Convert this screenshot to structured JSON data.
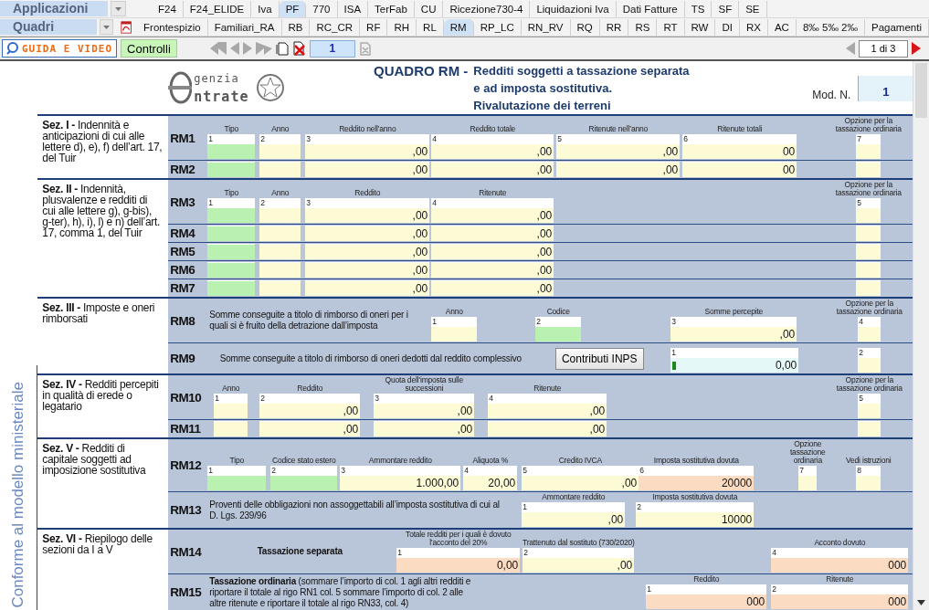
{
  "menus": [
    {
      "label": "Applicazioni",
      "has_pdf": false,
      "tabs": [
        {
          "label": "F24",
          "selected": false
        },
        {
          "label": "F24_ELIDE",
          "selected": false
        },
        {
          "label": "Iva",
          "selected": false
        },
        {
          "label": "PF",
          "selected": true
        },
        {
          "label": "770",
          "selected": false
        },
        {
          "label": "ISA",
          "selected": false
        },
        {
          "label": "TerFab",
          "selected": false
        },
        {
          "label": "CU",
          "selected": false
        },
        {
          "label": "Ricezione730-4",
          "selected": false
        },
        {
          "label": "Liquidazioni Iva",
          "selected": false
        },
        {
          "label": "Dati Fatture",
          "selected": false
        },
        {
          "label": "TS",
          "selected": false
        },
        {
          "label": "SF",
          "selected": false
        },
        {
          "label": "SE",
          "selected": false
        }
      ]
    },
    {
      "label": "Quadri",
      "has_pdf": true,
      "tabs": [
        {
          "label": "Frontespizio",
          "selected": false
        },
        {
          "label": "Familiari_RA",
          "selected": false
        },
        {
          "label": "RB",
          "selected": false
        },
        {
          "label": "RC_CR",
          "selected": false
        },
        {
          "label": "RF",
          "selected": false
        },
        {
          "label": "RH",
          "selected": false
        },
        {
          "label": "RL",
          "selected": false
        },
        {
          "label": "RM",
          "selected": true
        },
        {
          "label": "RP_LC",
          "selected": false
        },
        {
          "label": "RN_RV",
          "selected": false
        },
        {
          "label": "RQ",
          "selected": false
        },
        {
          "label": "RR",
          "selected": false
        },
        {
          "label": "RS",
          "selected": false
        },
        {
          "label": "RT",
          "selected": false
        },
        {
          "label": "RW",
          "selected": false
        },
        {
          "label": "DI",
          "selected": false
        },
        {
          "label": "RX",
          "selected": false
        },
        {
          "label": "AC",
          "selected": false
        },
        {
          "label": "8‰ 5‰ 2‰",
          "selected": false
        },
        {
          "label": "Pagamenti",
          "selected": false
        }
      ]
    }
  ],
  "toolbar": {
    "guide_button": "GUIDA E VIDEO",
    "check_button": "Controlli",
    "page_field": "1",
    "page_count": "1 di 3"
  },
  "header": {
    "logo_top": "genzia",
    "logo_bottom": "ntrate",
    "title": "QUADRO RM -",
    "subtitle_lines": [
      "Redditi soggetti a tassazione separata",
      "e ad imposta sostitutiva.",
      "Rivalutazione dei terreni"
    ],
    "mod_label": "Mod. N.",
    "mod_value": "1"
  },
  "side_note": "Conforme al modello ministeriale",
  "sections": [
    {
      "label": "**Sez. I -** Indennità e anticipazioni di cui alle lettere d), e), f) dell’art. 17, del Tuir",
      "rows": [
        {
          "code": "RM1",
          "items": [
            {
              "kind": "code",
              "header": "Tipo",
              "num": "1"
            },
            {
              "kind": "amount",
              "header": "Anno",
              "num": "2"
            },
            {
              "kind": "amount",
              "header": "Reddito nell’anno",
              "num": "3",
              "value": ",00"
            },
            {
              "kind": "amount",
              "header": "Reddito totale",
              "num": "4",
              "value": ",00"
            },
            {
              "kind": "amount",
              "header": "Ritenute nell’anno",
              "num": "5",
              "value": ",00"
            },
            {
              "kind": "amount",
              "header": "Ritenute totali",
              "num": "6",
              "value": "00"
            },
            {
              "kind": "amount",
              "header": "Opzione per la tassazione ordinaria",
              "num": "7"
            }
          ]
        },
        {
          "code": "RM2",
          "items": [
            {
              "kind": "code"
            },
            {
              "kind": "amount"
            },
            {
              "kind": "amount",
              "value": ",00"
            },
            {
              "kind": "amount",
              "value": ",00"
            },
            {
              "kind": "amount",
              "value": ",00"
            },
            {
              "kind": "amount",
              "value": "00"
            },
            {
              "kind": "amount"
            }
          ]
        }
      ]
    },
    {
      "label": "**Sez. II -** Indennità, plusvalenze e redditi di cui alle lettere g), g-bis), g-ter), h), i), l) e n) dell’art. 17, comma 1, del Tuir",
      "rows": [
        {
          "code": "RM3",
          "items": [
            {
              "kind": "code",
              "header": "Tipo",
              "num": "1"
            },
            {
              "kind": "amount",
              "header": "Anno",
              "num": "2"
            },
            {
              "kind": "amount",
              "header": "Reddito",
              "num": "3",
              "value": ",00"
            },
            {
              "kind": "amount",
              "header": "Ritenute",
              "num": "4",
              "value": ",00"
            },
            {
              "kind": "amount",
              "header": "Opzione per la tassazione ordinaria",
              "num": "5"
            }
          ]
        },
        {
          "code": "RM4",
          "items": [
            {
              "kind": "code"
            },
            {
              "kind": "amount"
            },
            {
              "kind": "amount",
              "value": ",00"
            },
            {
              "kind": "amount",
              "value": ",00"
            },
            {
              "kind": "amount"
            }
          ]
        },
        {
          "code": "RM5",
          "items": [
            {
              "kind": "code"
            },
            {
              "kind": "amount"
            },
            {
              "kind": "amount",
              "value": ",00"
            },
            {
              "kind": "amount",
              "value": ",00"
            },
            {
              "kind": "amount"
            }
          ]
        },
        {
          "code": "RM6",
          "items": [
            {
              "kind": "code"
            },
            {
              "kind": "amount"
            },
            {
              "kind": "amount",
              "value": ",00"
            },
            {
              "kind": "amount",
              "value": ",00"
            },
            {
              "kind": "amount"
            }
          ]
        },
        {
          "code": "RM7",
          "items": [
            {
              "kind": "code"
            },
            {
              "kind": "amount"
            },
            {
              "kind": "amount",
              "value": ",00"
            },
            {
              "kind": "amount",
              "value": ",00"
            },
            {
              "kind": "amount"
            }
          ]
        }
      ]
    },
    {
      "label": "**Sez. III -** Imposte e oneri rimborsati",
      "rows": [
        {
          "code": "RM8",
          "items": [
            {
              "kind": "text",
              "text": "Somme conseguite a titolo di rimborso di oneri per i quali si è fruito della detrazione dall’imposta",
              "bold": false
            },
            {
              "kind": "amount",
              "header": "Anno",
              "num": "1"
            },
            {
              "kind": "code",
              "header": "Codice",
              "num": "2"
            },
            {
              "kind": "amount",
              "header": "Somme percepite",
              "num": "3",
              "value": ",00"
            },
            {
              "kind": "amount",
              "header": "Opzione per la tassazione ordinaria",
              "num": "4"
            }
          ]
        },
        {
          "code": "RM9",
          "items": [
            {
              "kind": "text",
              "text": "Somme conseguite a titolo di rimborso di oneri dedotti dal reddito complessivo",
              "bold": false
            },
            {
              "kind": "button",
              "text": "Contributi INPS"
            },
            {
              "kind": "computed",
              "num": "1",
              "value": "0,00"
            },
            {
              "kind": "amount",
              "num": "2"
            }
          ]
        }
      ]
    },
    {
      "label": "**Sez. IV -** Redditi percepiti in qualità di erede o legatario",
      "rows": [
        {
          "code": "RM10",
          "items": [
            {
              "kind": "amount",
              "header": "Anno",
              "num": "1"
            },
            {
              "kind": "amount",
              "header": "Reddito",
              "num": "2",
              "value": ",00"
            },
            {
              "kind": "amount",
              "header": "Quota dell’imposta sulle successioni",
              "num": "3",
              "value": ",00"
            },
            {
              "kind": "amount",
              "header": "Ritenute",
              "num": "4",
              "value": ",00"
            },
            {
              "kind": "amount",
              "header": "Opzione per la tassazione ordinaria",
              "num": "5"
            }
          ]
        },
        {
          "code": "RM11",
          "items": [
            {
              "kind": "amount"
            },
            {
              "kind": "amount",
              "value": ",00"
            },
            {
              "kind": "amount",
              "value": ",00"
            },
            {
              "kind": "amount",
              "value": ",00"
            },
            {
              "kind": "amount"
            }
          ]
        }
      ]
    },
    {
      "label": "**Sez. V -** Redditi di capitale soggetti ad imposizione sostitutiva",
      "rows": [
        {
          "code": "RM12",
          "items": [
            {
              "kind": "code",
              "header": "Tipo",
              "num": "1"
            },
            {
              "kind": "code",
              "header": "Codice stato estero",
              "num": "2"
            },
            {
              "kind": "amount",
              "header": "Ammontare reddito",
              "num": "3",
              "value": "1.000,00"
            },
            {
              "kind": "amount",
              "header": "Aliquota %",
              "num": "4",
              "value": "20,00"
            },
            {
              "kind": "amount",
              "header": "Credito IVCA",
              "num": "5",
              "value": ",00"
            },
            {
              "kind": "due",
              "header": "Imposta sostitutiva dovuta",
              "num": "6",
              "value": "20000"
            },
            {
              "kind": "amount",
              "header": "Opzione tassazione ordinaria",
              "num": "7"
            },
            {
              "kind": "amount",
              "header": "Vedi istruzioni",
              "num": "8"
            }
          ]
        },
        {
          "code": "RM13",
          "items": [
            {
              "kind": "text",
              "text": "Proventi delle obbligazioni non assoggettabili all’imposta sostitutiva di cui al D. Lgs. 239/96",
              "bold": false
            },
            {
              "kind": "amount",
              "header": "Ammontare reddito",
              "num": "1",
              "value": ",00"
            },
            {
              "kind": "amount",
              "header": "Imposta sostitutiva dovuta",
              "num": "2",
              "value": "10000"
            }
          ]
        }
      ]
    },
    {
      "label": "**Sez. VI -** Riepilogo delle sezioni da I a V",
      "rows": [
        {
          "code": "RM14",
          "items": [
            {
              "kind": "text",
              "text": "Tassazione separata",
              "bold": true
            },
            {
              "kind": "due",
              "header": "Totale redditi per i quali è dovuto l’acconto del 20%",
              "num": "1",
              "value": "0,00"
            },
            {
              "kind": "amount",
              "header": "Trattenuto dal sostituto (730/2020)",
              "num": "2",
              "value": ",00"
            },
            {
              "kind": "due",
              "header": "Acconto dovuto",
              "num": "4",
              "value": "000"
            }
          ]
        },
        {
          "code": "RM15",
          "items": [
            {
              "kind": "text",
              "text": "**Tassazione ordinaria** (sommare l’importo di col. 1 agli altri redditi e riportare il totale al rigo RN1 col. 5 sommare l’importo di col. 2 alle altre ritenute e riportare il totale al rigo RN33, col. 4)",
              "bold": false
            },
            {
              "kind": "due",
              "header": "Reddito",
              "num": "1",
              "value": "000"
            },
            {
              "kind": "due",
              "header": "Ritenute",
              "num": "2",
              "value": "000"
            }
          ]
        }
      ]
    }
  ]
}
